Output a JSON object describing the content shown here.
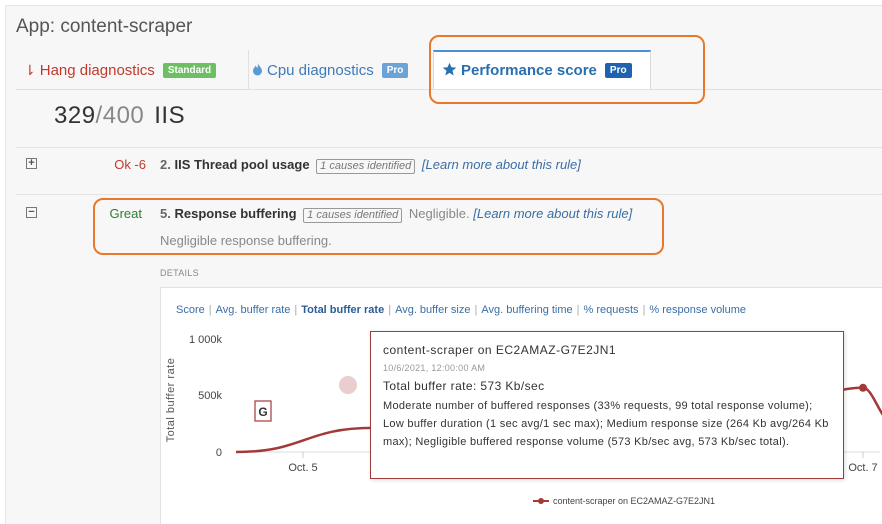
{
  "app": {
    "title": "App: content-scraper"
  },
  "tabs": [
    {
      "label": "Hang diagnostics",
      "badge": "Standard",
      "icon": "sort-desc-icon"
    },
    {
      "label": "Cpu diagnostics",
      "badge": "Pro",
      "icon": "flame-icon"
    },
    {
      "label": "Performance score",
      "badge": "Pro",
      "icon": "star-icon",
      "active": true
    }
  ],
  "score": {
    "value": "329",
    "max": "/400",
    "server": "IIS"
  },
  "rules": [
    {
      "toggle": "+",
      "status": "Ok -6",
      "status_color": "#c0392b",
      "number": "2.",
      "name": "IIS Thread pool usage",
      "causes": "1 causes identified",
      "link": "[Learn more about this rule]"
    },
    {
      "toggle": "−",
      "status": "Great",
      "status_color": "#2e7d32",
      "number": "5.",
      "name": "Response buffering",
      "causes": "1 causes identified",
      "impact": "Negligible.",
      "link": "[Learn more about this rule]",
      "description": "Negligible response buffering."
    }
  ],
  "details": {
    "label": "DETAILS",
    "metrics": [
      "Score",
      "Avg. buffer rate",
      "Total buffer rate",
      "Avg. buffer size",
      "Avg. buffering time",
      "% requests",
      "% response volume"
    ],
    "active_metric": "Total buffer rate"
  },
  "chart_data": {
    "type": "line",
    "ylabel": "Total buffer rate",
    "yticks": [
      "1 000k",
      "500k",
      "0"
    ],
    "ylim": [
      0,
      1000
    ],
    "xticks": [
      "Oct. 5",
      "Oct. 7"
    ],
    "series": [
      {
        "name": "content-scraper on EC2AMAZ-G7E2JN1",
        "color": "#a33a3a",
        "x": [
          "2021-10-04T00:00",
          "2021-10-04T18:00",
          "2021-10-05T00:00",
          "2021-10-05T18:00",
          "2021-10-06T00:00",
          "2021-10-06T12:00"
        ],
        "y": [
          0,
          215,
          25,
          10,
          10,
          573
        ]
      }
    ],
    "annotation": "G",
    "highlighted_point": {
      "x": "2021-10-06T00:00",
      "y": 573
    }
  },
  "tooltip": {
    "title": "content-scraper on EC2AMAZ-G7E2JN1",
    "date": "10/6/2021, 12:00:00 AM",
    "rate": "Total buffer rate: 573 Kb/sec",
    "body": "Moderate number of buffered responses (33% requests, 99 total response volume); Low buffer duration (1 sec avg/1 sec max); Medium response size (264 Kb avg/264 Kb max); Negligible buffered response volume (573 Kb/sec avg, 573 Kb/sec total)."
  },
  "legend": {
    "label": "content-scraper on EC2AMAZ-G7E2JN1"
  }
}
